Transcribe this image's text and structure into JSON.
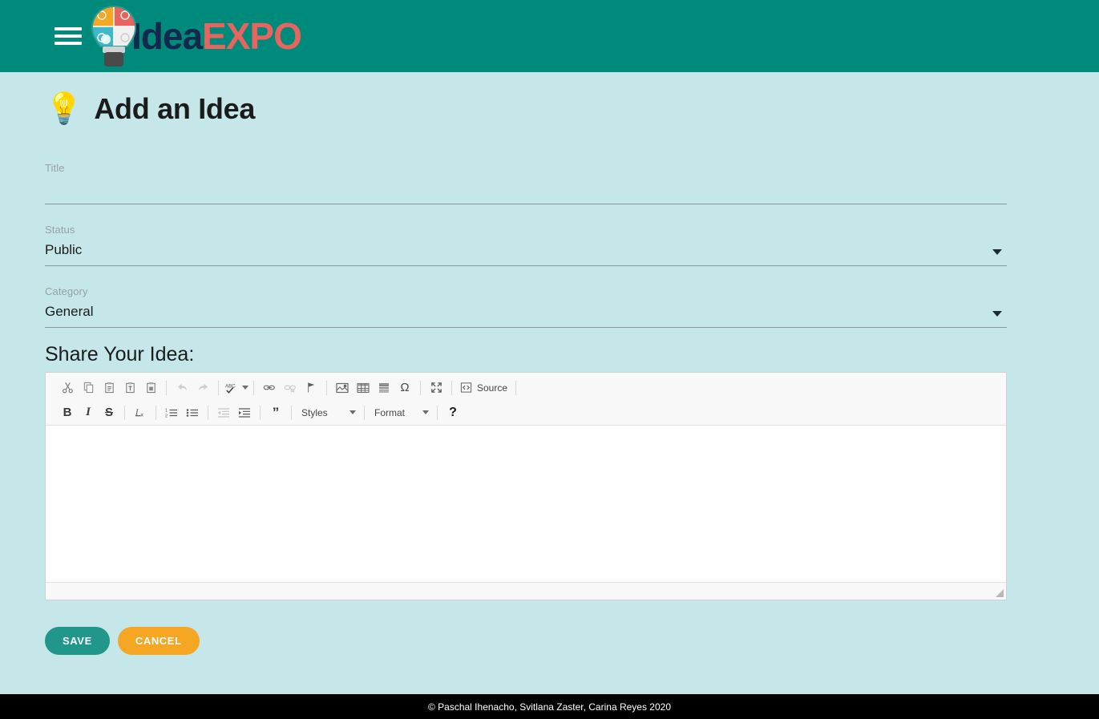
{
  "colors": {
    "header_bg": "#008a7c",
    "page_bg": "#c5e7ea",
    "save_btn": "#21968a",
    "cancel_btn": "#f5a623",
    "footer_bg": "#000000",
    "wordmark_idea": "#12284c",
    "wordmark_expo": "#e8645e"
  },
  "header": {
    "menu_icon": "hamburger-icon",
    "logo_icon": "lightbulb-puzzle-logo",
    "brand_part1": "Idea",
    "brand_part2": "EXPO"
  },
  "page": {
    "title_icon": "💡",
    "title": "Add an Idea"
  },
  "form": {
    "title_field": {
      "label": "Title",
      "value": "",
      "placeholder": ""
    },
    "status_field": {
      "label": "Status",
      "value": "Public",
      "options": [
        "Public"
      ]
    },
    "category_field": {
      "label": "Category",
      "value": "General",
      "options": [
        "General"
      ]
    }
  },
  "editor": {
    "heading": "Share Your Idea:",
    "content": "",
    "toolbar_row1": [
      {
        "name": "cut-icon",
        "label": "Cut",
        "disabled": false
      },
      {
        "name": "copy-icon",
        "label": "Copy",
        "disabled": false
      },
      {
        "name": "paste-icon",
        "label": "Paste",
        "disabled": false
      },
      {
        "name": "paste-text-icon",
        "label": "Paste as plain text",
        "disabled": false
      },
      {
        "name": "paste-word-icon",
        "label": "Paste from Word",
        "disabled": false
      },
      {
        "name": "undo-icon",
        "label": "Undo",
        "disabled": true
      },
      {
        "name": "redo-icon",
        "label": "Redo",
        "disabled": true
      },
      {
        "name": "spellcheck-icon",
        "label": "Spell Check As You Type",
        "disabled": false
      },
      {
        "name": "link-icon",
        "label": "Link",
        "disabled": false
      },
      {
        "name": "unlink-icon",
        "label": "Unlink",
        "disabled": true
      },
      {
        "name": "anchor-icon",
        "label": "Anchor",
        "disabled": false
      },
      {
        "name": "image-icon",
        "label": "Image",
        "disabled": false
      },
      {
        "name": "table-icon",
        "label": "Table",
        "disabled": false
      },
      {
        "name": "horizontal-rule-icon",
        "label": "Horizontal Line",
        "disabled": false
      },
      {
        "name": "special-char-icon",
        "label": "Insert Special Character",
        "disabled": false
      },
      {
        "name": "maximize-icon",
        "label": "Maximize",
        "disabled": false
      }
    ],
    "source_button": {
      "icon": "source-icon",
      "label": "Source"
    },
    "toolbar_row2": [
      {
        "name": "bold-icon",
        "label": "B",
        "disabled": false
      },
      {
        "name": "italic-icon",
        "label": "I",
        "disabled": false
      },
      {
        "name": "strikethrough-icon",
        "label": "S",
        "disabled": false
      },
      {
        "name": "remove-format-icon",
        "label": "Remove Format",
        "disabled": false
      },
      {
        "name": "numbered-list-icon",
        "label": "Insert/Remove Numbered List",
        "disabled": false
      },
      {
        "name": "bulleted-list-icon",
        "label": "Insert/Remove Bulleted List",
        "disabled": false
      },
      {
        "name": "outdent-icon",
        "label": "Decrease Indent",
        "disabled": true
      },
      {
        "name": "indent-icon",
        "label": "Increase Indent",
        "disabled": false
      },
      {
        "name": "blockquote-icon",
        "label": "Block Quote",
        "disabled": false
      }
    ],
    "styles_dropdown": {
      "label": "Styles"
    },
    "format_dropdown": {
      "label": "Format"
    },
    "help_button": {
      "label": "?"
    }
  },
  "actions": {
    "save_label": "SAVE",
    "cancel_label": "CANCEL"
  },
  "footer": {
    "copyright": "© Paschal Ihenacho, Svitlana Zaster, Carina Reyes 2020"
  }
}
